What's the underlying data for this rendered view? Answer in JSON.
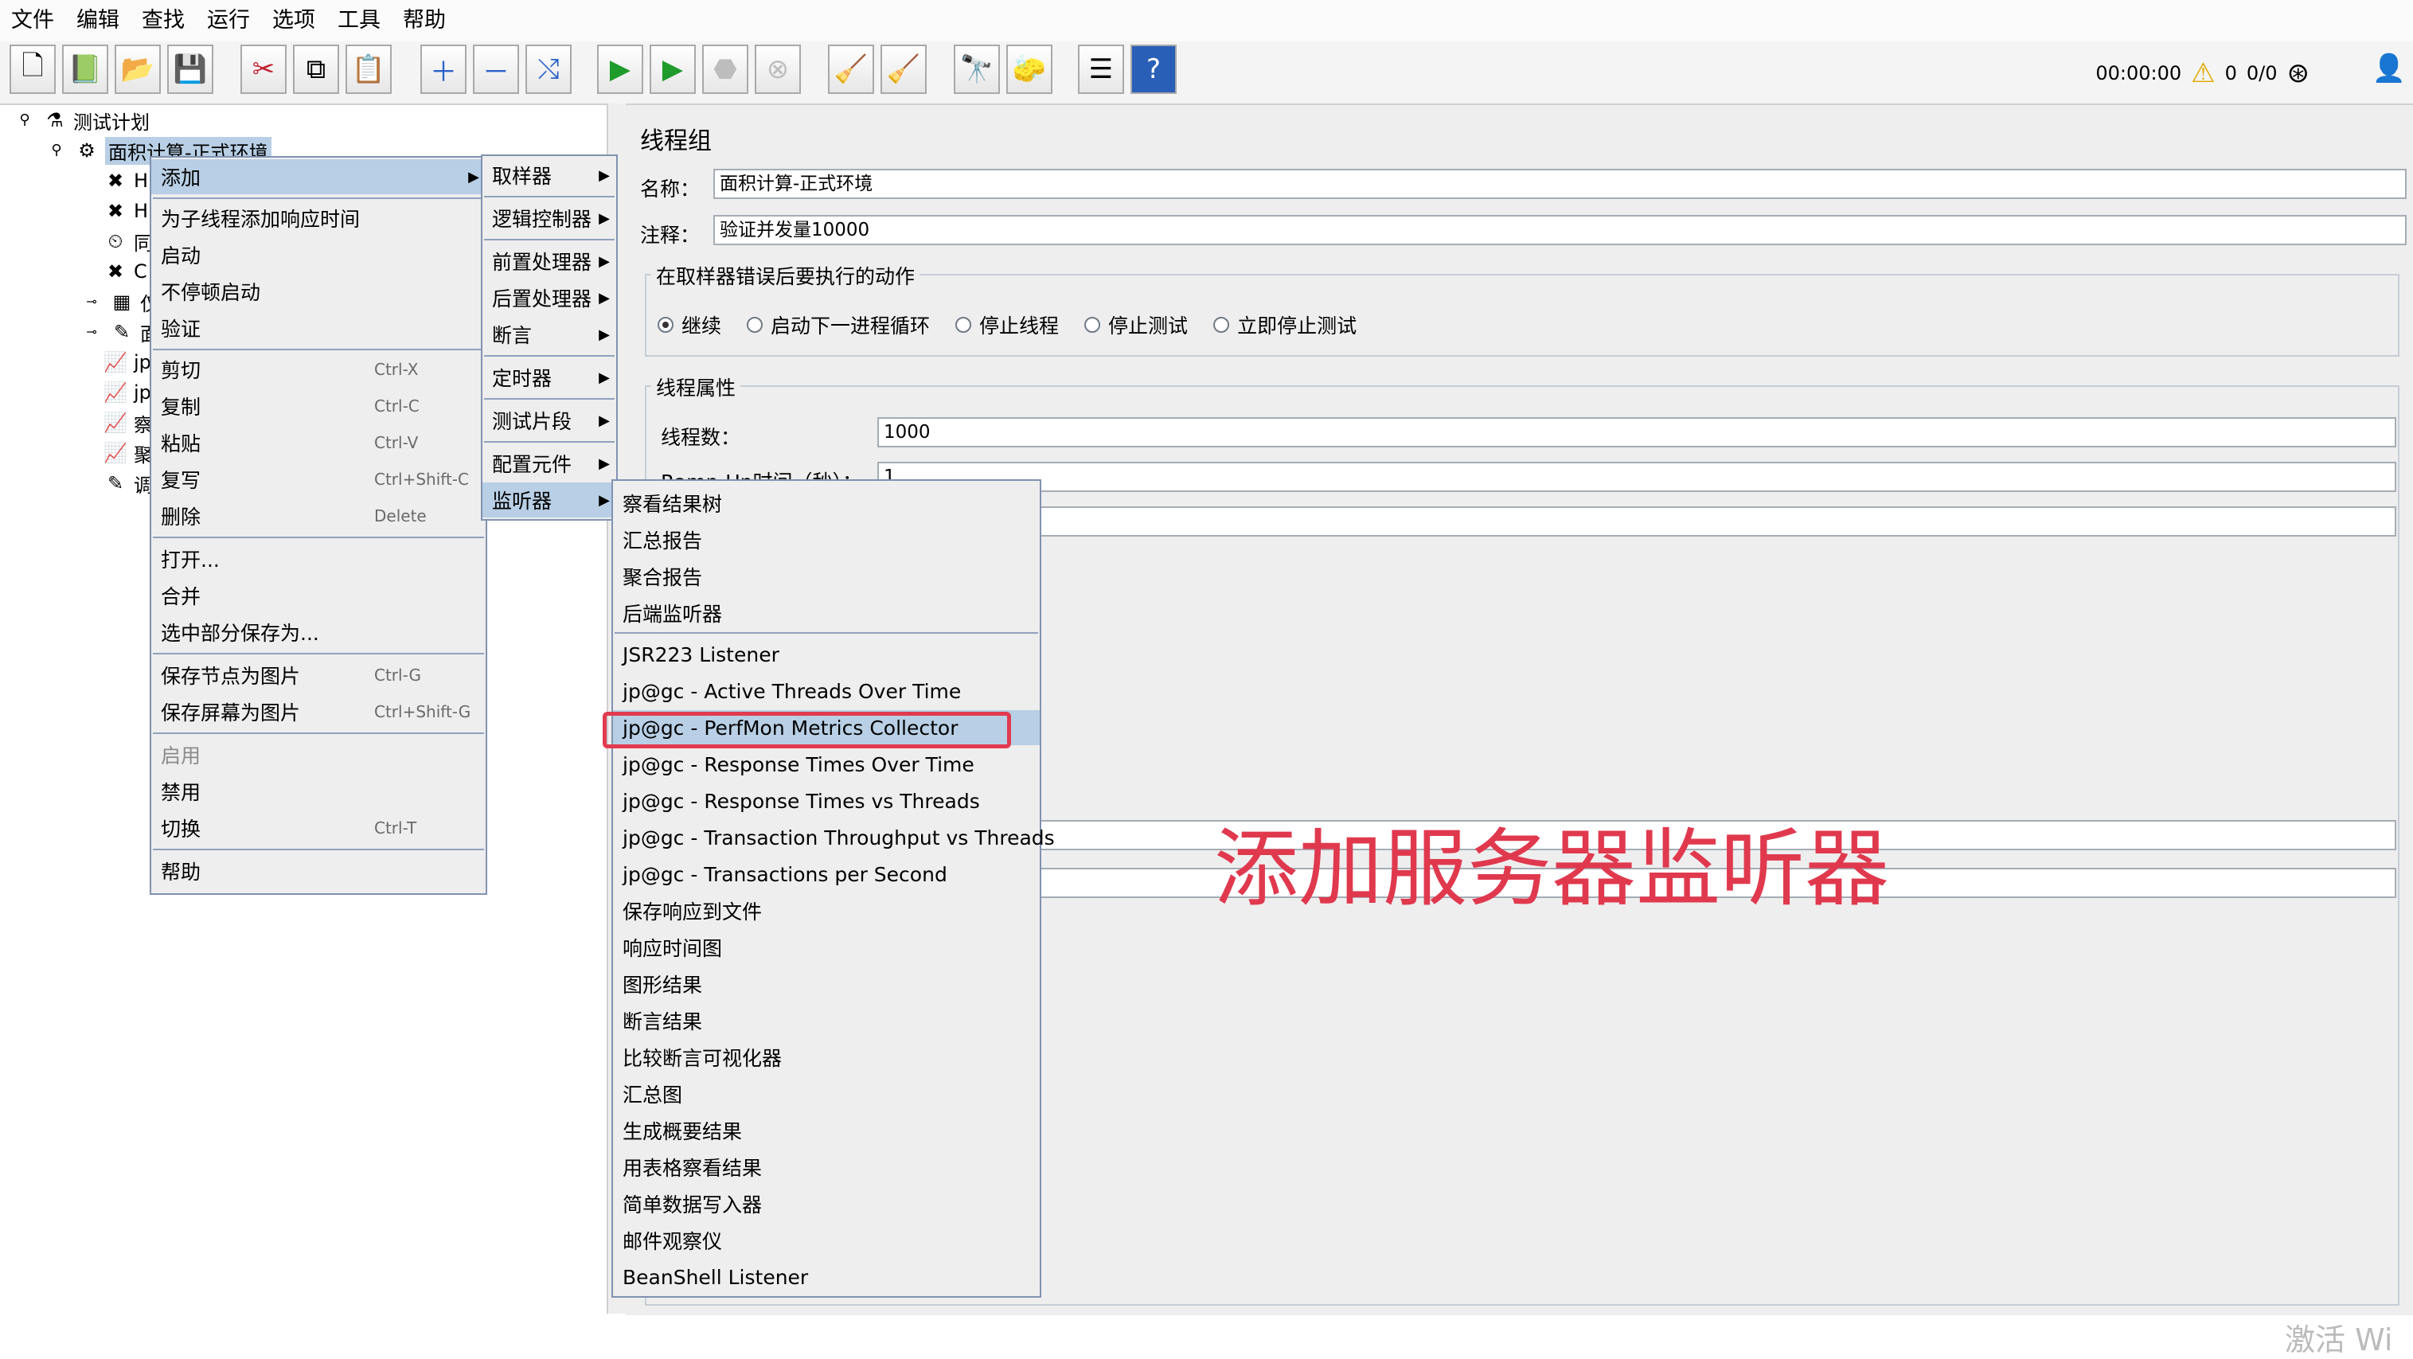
{
  "menubar": [
    "文件",
    "编辑",
    "查找",
    "运行",
    "选项",
    "工具",
    "帮助"
  ],
  "toolbar": {
    "timer": "00:00:00",
    "warnings": "0",
    "threads": "0/0"
  },
  "tree": {
    "root": "测试计划",
    "selected": "面积计算-正式环境",
    "children": [
      "H",
      "H",
      "同",
      "C",
      "仅",
      "面",
      "jp",
      "jp",
      "察",
      "聚",
      "调"
    ]
  },
  "panel": {
    "title": "线程组",
    "name_label": "名称：",
    "name_value": "面积计算-正式环境",
    "comment_label": "注释：",
    "comment_value": "验证并发量10000",
    "error_group": "在取样器错误后要执行的动作",
    "radios": [
      "继续",
      "启动下一进程循环",
      "停止线程",
      "停止测试",
      "立即停止测试"
    ],
    "thread_group": "线程属性",
    "threads_label": "线程数：",
    "threads_value": "1000",
    "rampup_label": "Ramp-Up时间（秒）：",
    "rampup_value": "1"
  },
  "context_menu": [
    {
      "label": "添加",
      "submenu": true,
      "highlight": true
    },
    {
      "label": "为子线程添加响应时间"
    },
    {
      "label": "启动"
    },
    {
      "label": "不停顿启动"
    },
    {
      "label": "验证"
    },
    {
      "label": "剪切",
      "shortcut": "Ctrl-X"
    },
    {
      "label": "复制",
      "shortcut": "Ctrl-C"
    },
    {
      "label": "粘贴",
      "shortcut": "Ctrl-V"
    },
    {
      "label": "复写",
      "shortcut": "Ctrl+Shift-C"
    },
    {
      "label": "删除",
      "shortcut": "Delete"
    },
    {
      "label": "打开..."
    },
    {
      "label": "合并"
    },
    {
      "label": "选中部分保存为..."
    },
    {
      "label": "保存节点为图片",
      "shortcut": "Ctrl-G"
    },
    {
      "label": "保存屏幕为图片",
      "shortcut": "Ctrl+Shift-G"
    },
    {
      "label": "启用",
      "disabled": true
    },
    {
      "label": "禁用"
    },
    {
      "label": "切换",
      "shortcut": "Ctrl-T"
    },
    {
      "label": "帮助"
    }
  ],
  "add_menu": [
    "取样器",
    "逻辑控制器",
    "前置处理器",
    "后置处理器",
    "断言",
    "定时器",
    "测试片段",
    "配置元件",
    "监听器"
  ],
  "listener_menu": [
    "察看结果树",
    "汇总报告",
    "聚合报告",
    "后端监听器",
    "JSR223 Listener",
    "jp@gc - Active Threads Over Time",
    "jp@gc - PerfMon Metrics Collector",
    "jp@gc - Response Times Over Time",
    "jp@gc - Response Times vs Threads",
    "jp@gc - Transaction Throughput vs Threads",
    "jp@gc - Transactions per Second",
    "保存响应到文件",
    "响应时间图",
    "图形结果",
    "断言结果",
    "比较断言可视化器",
    "汇总图",
    "生成概要结果",
    "用表格察看结果",
    "简单数据写入器",
    "邮件观察仪",
    "BeanShell Listener"
  ],
  "annotation": "添加服务器监听器",
  "watermark": "激活 Wi",
  "colors": {
    "highlight": "#b8cfe5",
    "annotation": "#e0394e",
    "menu_bg": "#eeeeee"
  }
}
